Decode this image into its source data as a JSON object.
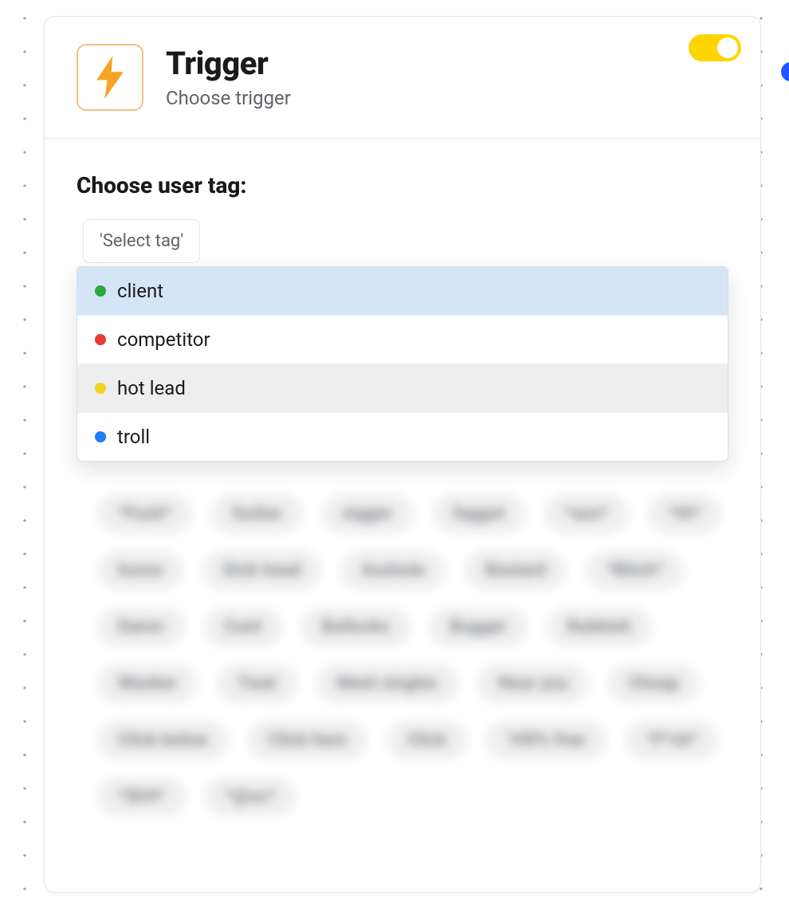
{
  "header": {
    "title": "Trigger",
    "subtitle": "Choose trigger",
    "toggle_on": true,
    "accent_color": "#ffd400",
    "icon_color": "#f7a324"
  },
  "section": {
    "label": "Choose user tag:",
    "select_placeholder": "'Select tag'"
  },
  "tag_options": [
    {
      "label": "client",
      "color": "#2aa83f",
      "state": "selected"
    },
    {
      "label": "competitor",
      "color": "#e63b2e",
      "state": ""
    },
    {
      "label": "hot lead",
      "color": "#f2d21f",
      "state": "hover"
    },
    {
      "label": "troll",
      "color": "#1f7bff",
      "state": ""
    }
  ],
  "blurred_pills": [
    "*Fuck*",
    "fucker",
    "nigger",
    "faggot",
    "*ass*",
    "*tit*",
    "homo",
    "Dick head",
    "Asshole",
    "Bastard",
    "*Bitch*",
    "Damn",
    "Cunt",
    "Bollocks",
    "Bugger",
    "Rubbish",
    "Wanker",
    "Twat",
    "Meet singles",
    "Near you",
    "Cheap",
    "Click below",
    "Click here",
    "Click",
    "100% free",
    "*F*ck*",
    "*Sh!t*",
    "*@ss*"
  ]
}
